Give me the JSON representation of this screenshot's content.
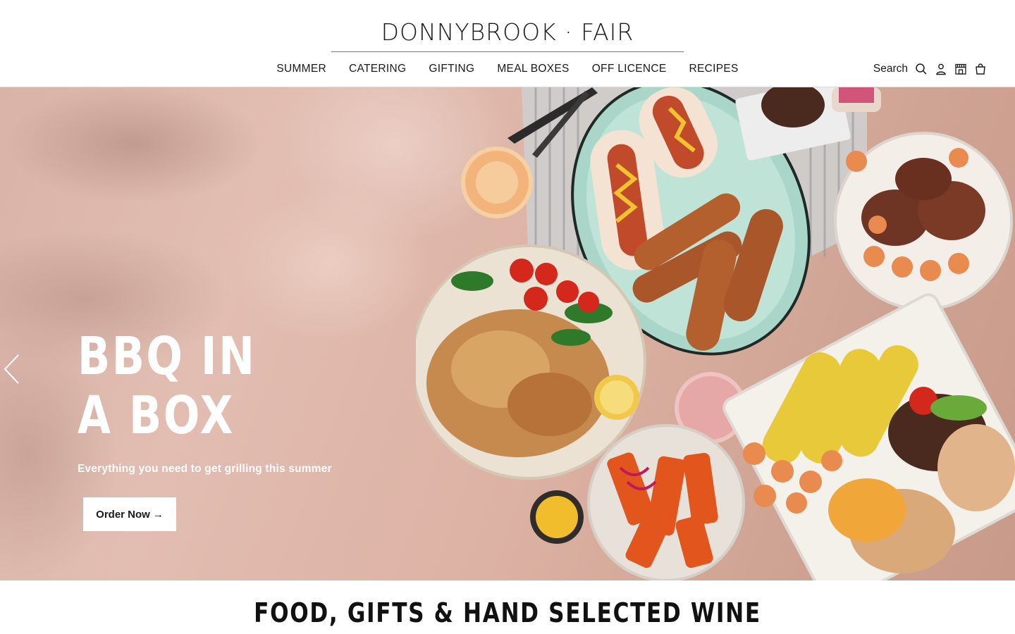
{
  "brand": {
    "logo_text": "DONNYBROOK · FAIR"
  },
  "nav": {
    "items": [
      {
        "label": "SUMMER"
      },
      {
        "label": "CATERING"
      },
      {
        "label": "GIFTING"
      },
      {
        "label": "MEAL BOXES"
      },
      {
        "label": "OFF LICENCE"
      },
      {
        "label": "RECIPES"
      }
    ]
  },
  "utility": {
    "search_label": "Search",
    "icons": [
      "search-icon",
      "account-icon",
      "store-icon",
      "bag-icon"
    ]
  },
  "hero": {
    "title_line1": "BBQ IN",
    "title_line2": "A BOX",
    "subtitle": "Everything you need to get grilling this summer",
    "cta_label": "Order Now",
    "cta_arrow": "→",
    "image_description_icon": "bbq-food-spread-image"
  },
  "section": {
    "title": "FOOD, GIFTS & HAND SELECTED WINE"
  },
  "colors": {
    "hero_bg": "#dcb2a4",
    "text": "#1a1a1a",
    "white": "#ffffff"
  }
}
